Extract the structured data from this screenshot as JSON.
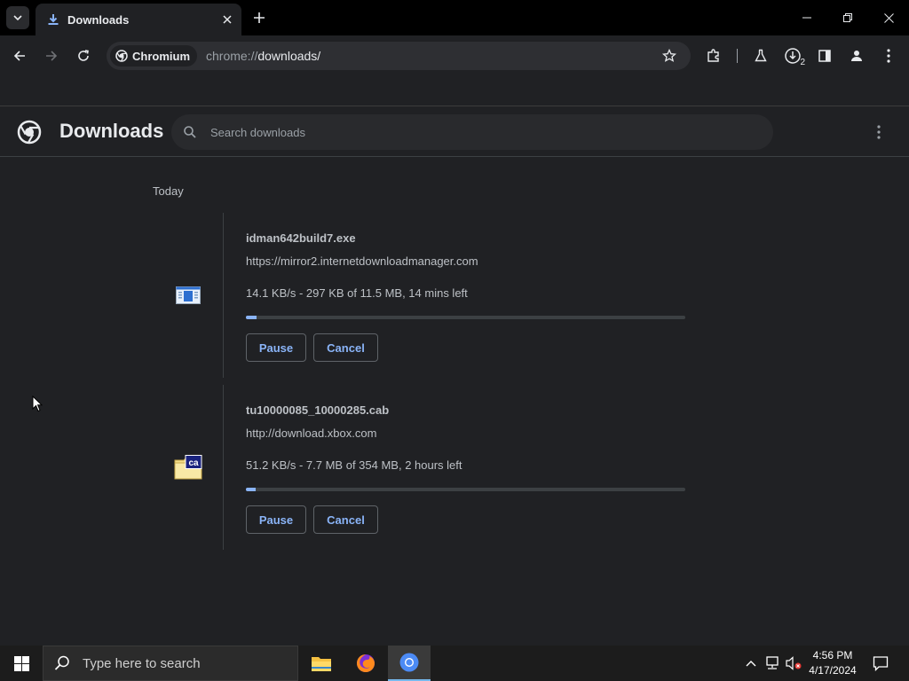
{
  "browser": {
    "tab_title": "Downloads",
    "site_chip": "Chromium",
    "url_prefix": "chrome://",
    "url_path": "downloads/",
    "downloads_badge": "2"
  },
  "page": {
    "title": "Downloads",
    "search_placeholder": "Search downloads",
    "section_label": "Today"
  },
  "downloads": [
    {
      "filename": "idman642build7.exe",
      "url": "https://mirror2.internetdownloadmanager.com",
      "status": "14.1 KB/s - 297 KB of 11.5 MB, 14 mins left",
      "progress": 0.025,
      "pause_label": "Pause",
      "cancel_label": "Cancel",
      "icon": "exe-file-icon"
    },
    {
      "filename": "tu10000085_10000285.cab",
      "url": "http://download.xbox.com",
      "status": "51.2 KB/s - 7.7 MB of 354 MB, 2 hours left",
      "progress": 0.022,
      "pause_label": "Pause",
      "cancel_label": "Cancel",
      "icon": "cab-file-icon"
    }
  ],
  "taskbar": {
    "search_placeholder": "Type here to search",
    "time": "4:56 PM",
    "date": "4/17/2024"
  },
  "colors": {
    "accent": "#8ab4f8",
    "background": "#202124",
    "text": "#e8eaed"
  }
}
